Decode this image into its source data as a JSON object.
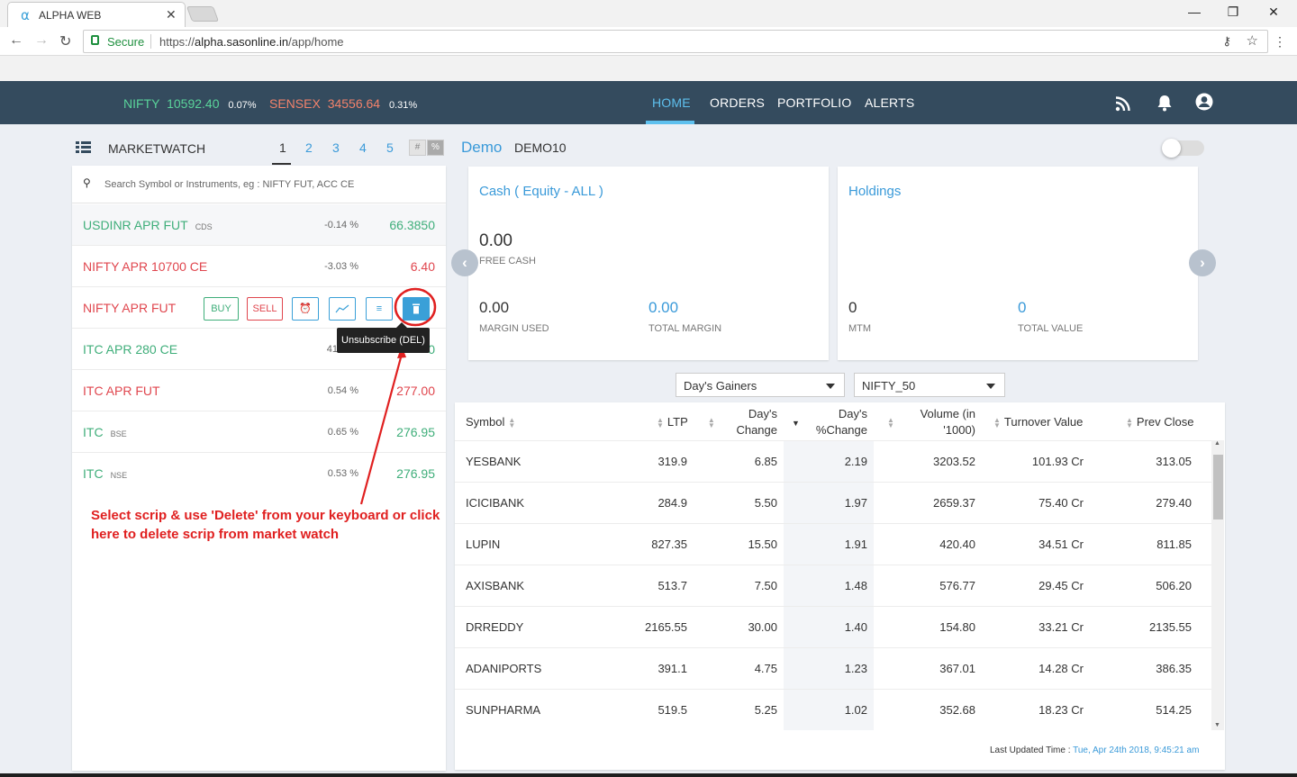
{
  "browser": {
    "tab_title": "ALPHA WEB",
    "secure_label": "Secure",
    "url_prefix": "https://",
    "url_host": "alpha.sasonline.in",
    "url_path": "/app/home"
  },
  "header": {
    "tickers": [
      {
        "name": "NIFTY",
        "value": "10592.40",
        "change": "0.07%",
        "color": "#5ad39a"
      },
      {
        "name": "SENSEX",
        "value": "34556.64",
        "change": "0.31%",
        "color": "#f2826b"
      }
    ],
    "nav": [
      "HOME",
      "ORDERS",
      "PORTFOLIO",
      "ALERTS"
    ],
    "active_nav": "HOME"
  },
  "marketwatch": {
    "title": "MARKETWATCH",
    "pages": [
      "1",
      "2",
      "3",
      "4",
      "5"
    ],
    "toggles": [
      "#",
      "%"
    ],
    "search_placeholder": "Search Symbol or Instruments, eg : NIFTY FUT, ACC CE",
    "rows": [
      {
        "symbol": "USDINR APR FUT",
        "exchange": "CDS",
        "change": "-0.14 %",
        "ltp": "66.3850",
        "color": "green"
      },
      {
        "symbol": "NIFTY APR 10700 CE",
        "exchange": "",
        "change": "-3.03 %",
        "ltp": "6.40",
        "color": "red"
      },
      {
        "symbol": "NIFTY APR FUT",
        "exchange": "",
        "change": "",
        "ltp": "",
        "color": "red"
      },
      {
        "symbol": "ITC APR 280 CE",
        "exchange": "",
        "change": "41",
        "ltp": "0",
        "color": "green"
      },
      {
        "symbol": "ITC APR FUT",
        "exchange": "",
        "change": "0.54 %",
        "ltp": "277.00",
        "color": "red"
      },
      {
        "symbol": "ITC",
        "exchange": "BSE",
        "change": "0.65 %",
        "ltp": "276.95",
        "color": "green"
      },
      {
        "symbol": "ITC",
        "exchange": "NSE",
        "change": "0.53 %",
        "ltp": "276.95",
        "color": "green"
      }
    ],
    "actions": {
      "buy": "BUY",
      "sell": "SELL"
    },
    "tooltip": "Unsubscribe (DEL)",
    "annotation": "Select scrip & use 'Delete' from your keyboard or click here to delete scrip from market watch"
  },
  "account": {
    "name": "Demo",
    "id": "DEMO10"
  },
  "cards": {
    "cash": {
      "title": "Cash ( Equity - ALL )",
      "free_cash": "0.00",
      "free_cash_label": "FREE CASH",
      "margin_used": "0.00",
      "margin_used_label": "MARGIN USED",
      "total_margin": "0.00",
      "total_margin_label": "TOTAL MARGIN"
    },
    "holdings": {
      "title": "Holdings",
      "mtm": "0",
      "mtm_label": "MTM",
      "total_value": "0",
      "total_value_label": "TOTAL VALUE"
    }
  },
  "filters": {
    "type": "Day's Gainers",
    "index": "NIFTY_50"
  },
  "table": {
    "headers": [
      "Symbol",
      "LTP",
      "Day's Change",
      "Day's %Change",
      "Volume (in '1000)",
      "Turnover Value",
      "Prev Close"
    ],
    "rows": [
      [
        "YESBANK",
        "319.9",
        "6.85",
        "2.19",
        "3203.52",
        "101.93 Cr",
        "313.05"
      ],
      [
        "ICICIBANK",
        "284.9",
        "5.50",
        "1.97",
        "2659.37",
        "75.40 Cr",
        "279.40"
      ],
      [
        "LUPIN",
        "827.35",
        "15.50",
        "1.91",
        "420.40",
        "34.51 Cr",
        "811.85"
      ],
      [
        "AXISBANK",
        "513.7",
        "7.50",
        "1.48",
        "576.77",
        "29.45 Cr",
        "506.20"
      ],
      [
        "DRREDDY",
        "2165.55",
        "30.00",
        "1.40",
        "154.80",
        "33.21 Cr",
        "2135.55"
      ],
      [
        "ADANIPORTS",
        "391.1",
        "4.75",
        "1.23",
        "367.01",
        "14.28 Cr",
        "386.35"
      ],
      [
        "SUNPHARMA",
        "519.5",
        "5.25",
        "1.02",
        "352.68",
        "18.23 Cr",
        "514.25"
      ]
    ],
    "last_updated_label": "Last Updated Time :",
    "last_updated_value": "Tue, Apr 24th 2018, 9:45:21 am"
  }
}
